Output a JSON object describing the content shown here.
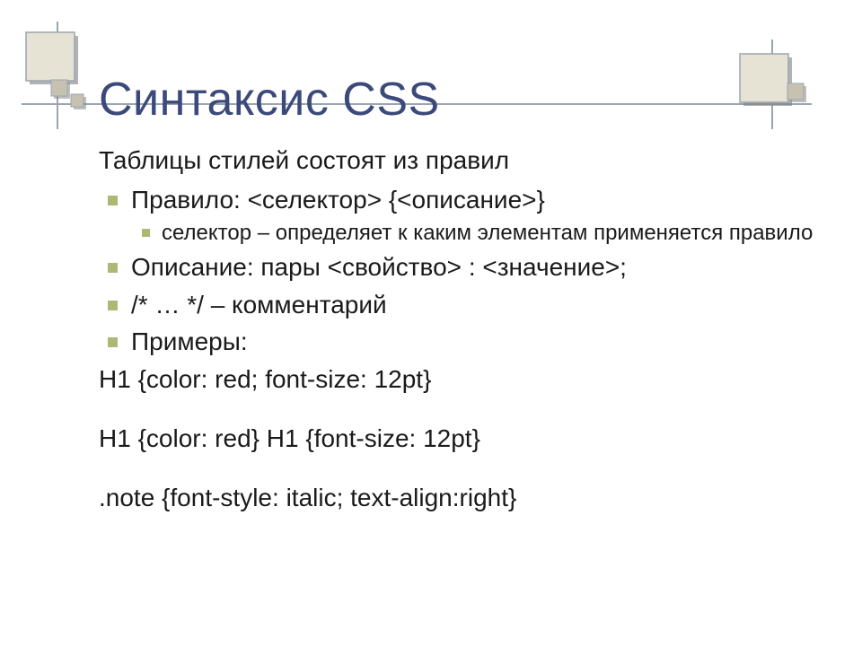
{
  "title": "Синтаксис CSS",
  "intro": "Таблицы стилей состоят из правил",
  "items": [
    {
      "text": "Правило: <селектор> {<описание>}",
      "sub": [
        "селектор – определяет к каким элементам применяется правило"
      ]
    },
    {
      "text": "Описание: пары <свойство> : <значение>;"
    },
    {
      "text": "/* … */ – комментарий"
    },
    {
      "text": "Примеры:"
    }
  ],
  "examples": [
    "H1 {color: red; font-size: 12pt}",
    "H1 {color: red} H1 {font-size: 12pt}",
    ".note {font-style: italic; text-align:right}"
  ],
  "decoration": {
    "square_fill": "#e6e2d4",
    "square_stroke": "#9aa5b1",
    "small_fill": "#c7c2b0",
    "shadow": "#7f7f7f"
  }
}
